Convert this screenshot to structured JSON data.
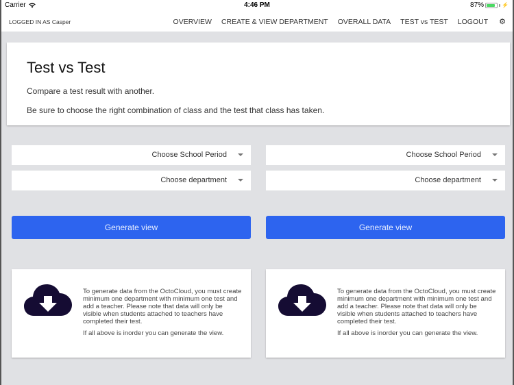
{
  "status_bar": {
    "carrier": "Carrier",
    "time": "4:46 PM",
    "battery_percent": "87%",
    "battery_level": 0.87,
    "battery_color": "#4cd964"
  },
  "nav": {
    "user_label": "LOGGED IN AS Casper",
    "links": [
      "OVERVIEW",
      "CREATE & VIEW DEPARTMENT",
      "OVERALL DATA",
      "TEST vs TEST",
      "LOGOUT"
    ],
    "settings_icon": "gear-icon"
  },
  "intro": {
    "title": "Test vs Test",
    "line1": "Compare a test result with another.",
    "line2": "Be sure to choose the right combination of class and the test that class has taken."
  },
  "columns": [
    {
      "school_period_placeholder": "Choose School Period",
      "department_placeholder": "Choose department",
      "generate_label": "Generate view",
      "info_icon": "cloud-download-icon",
      "info_text": "To generate data from the OctoCloud, you must create minimum one department with minimum one test and add a teacher. Please note that data will only be visible when students attached to teachers have completed their test.",
      "info_text2": "If all above is inorder you can generate the view."
    },
    {
      "school_period_placeholder": "Choose School Period",
      "department_placeholder": "Choose department",
      "generate_label": "Generate view",
      "info_icon": "cloud-download-icon",
      "info_text": "To generate data from the OctoCloud, you must create minimum one department with minimum one test and add a teacher. Please note that data will only be visible when students attached to teachers have completed their test.",
      "info_text2": "If all above is inorder you can generate the view."
    }
  ],
  "colors": {
    "primary_button": "#2d64ef",
    "cloud_icon": "#150c33",
    "background": "#e0e1e4"
  }
}
